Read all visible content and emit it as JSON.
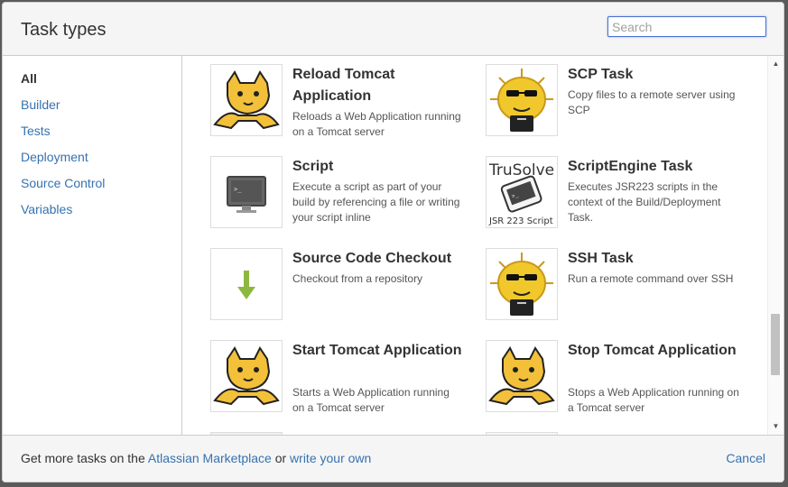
{
  "dialog": {
    "title": "Task types",
    "search_placeholder": "Search"
  },
  "sidebar": {
    "items": [
      {
        "label": "All",
        "active": true
      },
      {
        "label": "Builder"
      },
      {
        "label": "Tests"
      },
      {
        "label": "Deployment"
      },
      {
        "label": "Source Control"
      },
      {
        "label": "Variables"
      }
    ]
  },
  "tasks": [
    {
      "name": "Reload Tomcat Application",
      "description": "Reloads a Web Application running on a Tomcat server",
      "icon": "tomcat-icon"
    },
    {
      "name": "SCP Task",
      "description": "Copy files to a remote server using SCP",
      "icon": "puffer-fish-icon"
    },
    {
      "name": "Script",
      "description": "Execute a script as part of your build by referencing a file or writing your script inline",
      "icon": "terminal-icon"
    },
    {
      "name": "ScriptEngine Task",
      "description": "Executes JSR223 scripts in the context of the Build/Deployment Task.",
      "icon": "scriptengine-icon",
      "icon_text_top": "TruSolve",
      "icon_text_bottom": "JSR 223 Script"
    },
    {
      "name": "Source Code Checkout",
      "description": "Checkout from a repository",
      "icon": "download-arrow-icon"
    },
    {
      "name": "SSH Task",
      "description": "Run a remote command over SSH",
      "icon": "puffer-fish-icon"
    },
    {
      "name": "Start Tomcat Application",
      "description": "Starts a Web Application running on a Tomcat server",
      "icon": "tomcat-icon"
    },
    {
      "name": "Stop Tomcat Application",
      "description": "Stops a Web Application running on a Tomcat server",
      "icon": "tomcat-icon"
    }
  ],
  "footer": {
    "prefix": "Get more tasks on the ",
    "marketplace_link": "Atlassian Marketplace",
    "middle": " or ",
    "write_link": "write your own",
    "cancel": "Cancel"
  },
  "colors": {
    "link": "#3572b0",
    "tomcat_yellow": "#f3c03a",
    "arrow_green": "#8cb83f"
  }
}
